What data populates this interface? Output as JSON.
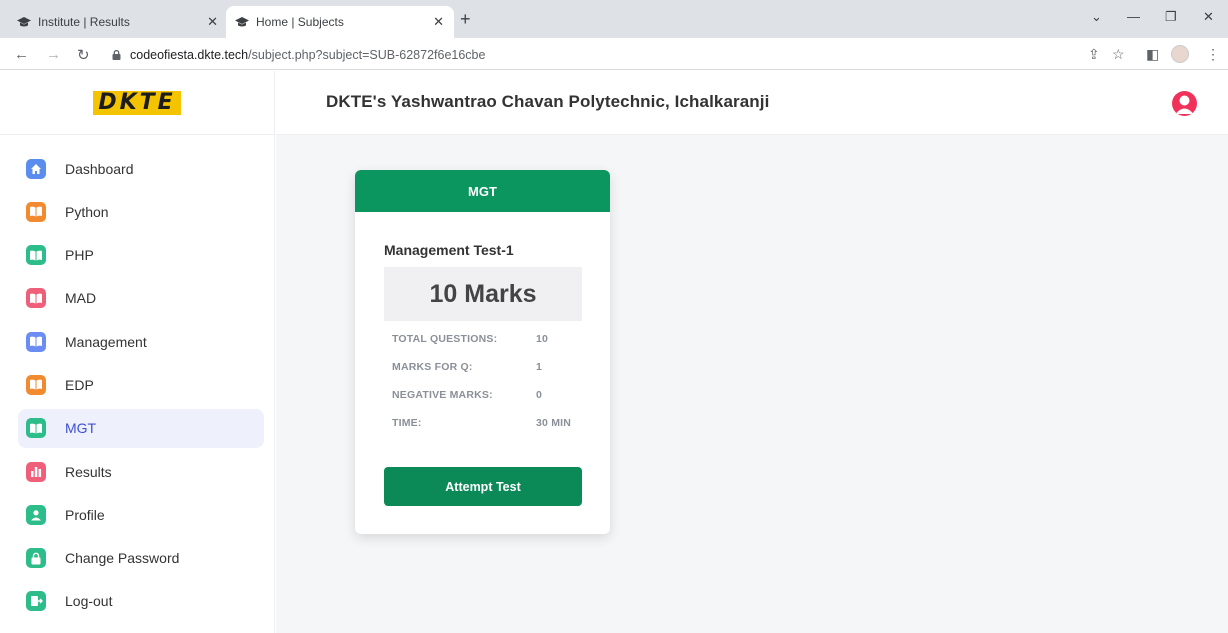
{
  "browser": {
    "tabs": [
      {
        "title": "Institute | Results",
        "active": false
      },
      {
        "title": "Home | Subjects",
        "active": true
      }
    ],
    "url_host": "codeofiesta.dkte.tech",
    "url_path": "/subject.php?subject=SUB-62872f6e16cbe"
  },
  "app": {
    "logo": "DKTE",
    "header_title": "DKTE's Yashwantrao Chavan Polytechnic, Ichalkaranji",
    "accent_color": "#0b955f",
    "active_menu_color": "#3d4fd6"
  },
  "sidebar": {
    "items": [
      {
        "label": "Dashboard",
        "icon": "home-icon",
        "color": "#5b8def"
      },
      {
        "label": "Python",
        "icon": "book-icon",
        "color": "#f28a30"
      },
      {
        "label": "PHP",
        "icon": "book-icon",
        "color": "#2dbd8a"
      },
      {
        "label": "MAD",
        "icon": "book-icon",
        "color": "#ef5f7a"
      },
      {
        "label": "Management",
        "icon": "book-icon",
        "color": "#6b8cf2"
      },
      {
        "label": "EDP",
        "icon": "book-icon",
        "color": "#f28a30"
      },
      {
        "label": "MGT",
        "icon": "book-icon",
        "color": "#2dbd8a",
        "active": true
      },
      {
        "label": "Results",
        "icon": "bar-chart-icon",
        "color": "#ef5f7a"
      },
      {
        "label": "Profile",
        "icon": "user-icon",
        "color": "#2dbd8a"
      },
      {
        "label": "Change Password",
        "icon": "lock-icon",
        "color": "#2dbd8a"
      },
      {
        "label": "Log-out",
        "icon": "logout-icon",
        "color": "#2dbd8a"
      }
    ]
  },
  "card": {
    "subject": "MGT",
    "test_name": "Management Test-1",
    "marks": "10 Marks",
    "details": [
      {
        "label": "TOTAL QUESTIONS:",
        "value": "10"
      },
      {
        "label": "MARKS FOR Q:",
        "value": "1"
      },
      {
        "label": "NEGATIVE MARKS:",
        "value": "0"
      },
      {
        "label": "TIME:",
        "value": "30 MIN"
      }
    ],
    "button_label": "Attempt Test"
  }
}
